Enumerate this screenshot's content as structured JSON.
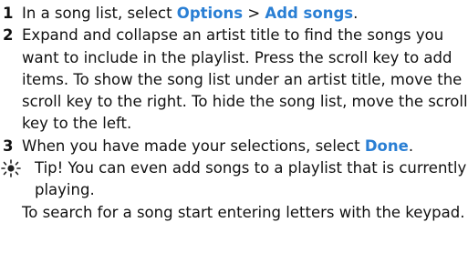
{
  "steps": [
    {
      "number": "1",
      "text_a": "In a song list, select ",
      "kw_a": "Options",
      "text_b": " > ",
      "kw_b": "Add songs",
      "text_c": "."
    },
    {
      "number": "2",
      "text": "Expand and collapse an artist title to find the songs you want to include in the playlist. Press the scroll key to add items. To show the song list under an artist title, move the scroll key to the right. To hide the song list, move the scroll key to the left."
    },
    {
      "number": "3",
      "text_a": "When you have made your selections, select ",
      "kw_a": "Done",
      "text_b": "."
    }
  ],
  "tip": {
    "icon": "tip-sun-icon",
    "text": "Tip! You can even add songs to a playlist that is currently playing.",
    "extra": "To search for a song start entering letters with the keypad."
  },
  "colors": {
    "keyword": "#2a7fd4",
    "text": "#111111",
    "icon": "#222222"
  }
}
